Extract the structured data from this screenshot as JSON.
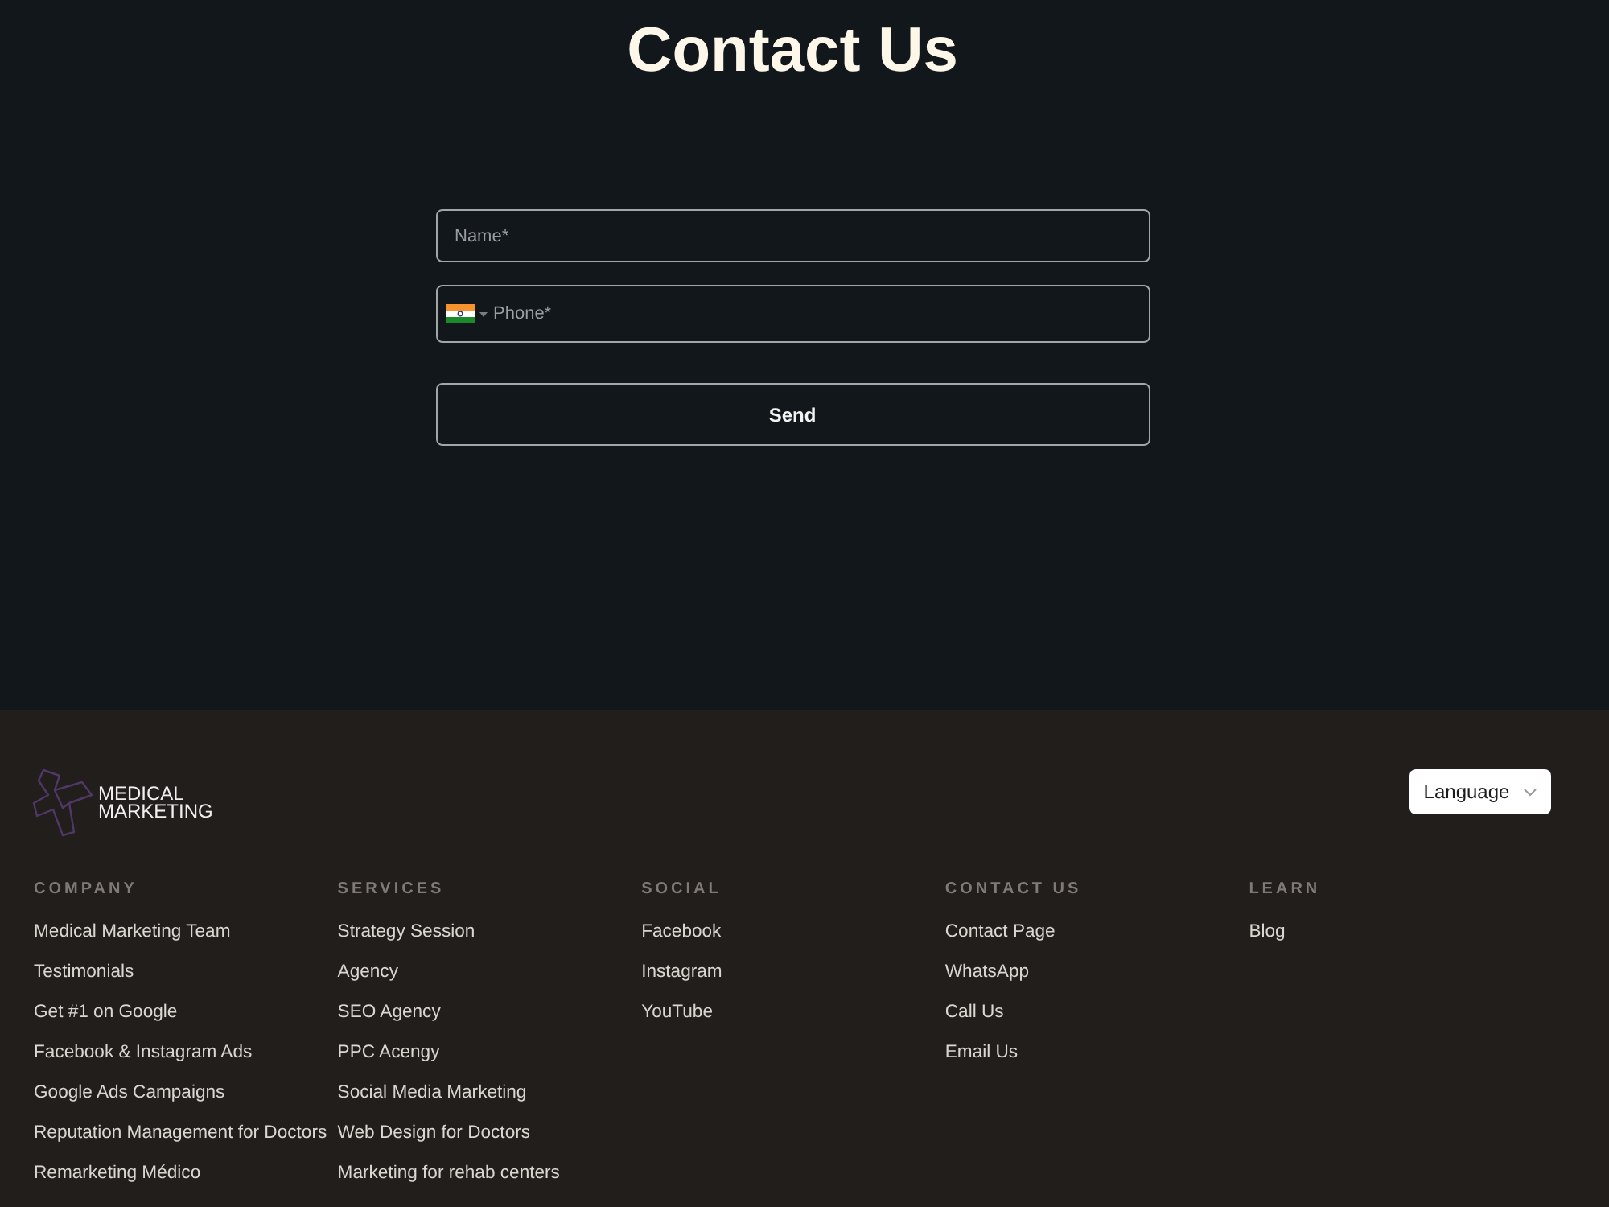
{
  "title": "Contact Us",
  "form": {
    "fields": [
      {
        "kind": "text",
        "placeholder": "Name*"
      },
      {
        "kind": "phone",
        "placeholder": "Phone*"
      }
    ],
    "submit": "Send"
  },
  "footer": {
    "logo_lines": [
      "MEDICAL",
      "MARKETING"
    ],
    "language": "Language",
    "columns": [
      {
        "heading": "COMPANY",
        "links": [
          "Medical Marketing Team",
          "Testimonials",
          "Get #1 on Google",
          "Facebook & Instagram Ads",
          "Google Ads Campaigns",
          "Reputation Management for Doctors",
          "Remarketing Médico"
        ]
      },
      {
        "heading": "SERVICES",
        "links": [
          "Strategy Session",
          "Agency",
          "SEO Agency",
          "PPC Acengy",
          "Social Media Marketing",
          "Web Design for Doctors",
          "Marketing for rehab centers"
        ]
      },
      {
        "heading": "SOCIAL",
        "links": [
          "Facebook",
          "Instagram",
          "YouTube"
        ]
      },
      {
        "heading": "CONTACT US",
        "links": [
          "Contact Page",
          "WhatsApp",
          "Call Us",
          "Email Us"
        ]
      },
      {
        "heading": "LEARN",
        "links": [
          "Blog"
        ]
      }
    ]
  }
}
